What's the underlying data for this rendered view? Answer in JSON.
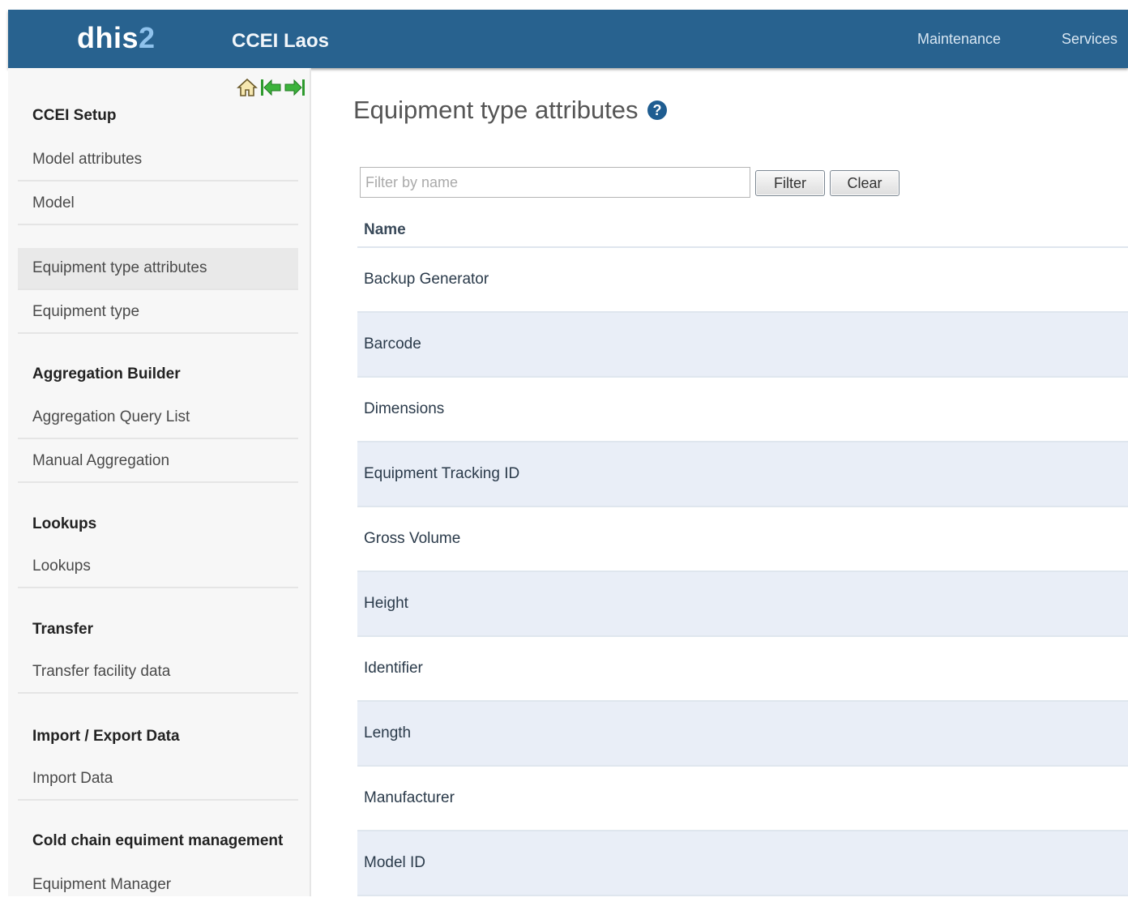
{
  "header": {
    "logo_main": "dhis",
    "logo_num": "2",
    "instance": "CCEI Laos",
    "nav": [
      "Maintenance",
      "Services"
    ]
  },
  "sidebar": {
    "icons": [
      "home-icon",
      "arrow-left-icon",
      "arrow-right-icon"
    ],
    "sections": [
      {
        "title": "CCEI Setup",
        "items": [
          "Model attributes",
          "Model",
          "Equipment type attributes",
          "Equipment type"
        ]
      },
      {
        "title": "Aggregation Builder",
        "items": [
          "Aggregation Query List",
          "Manual Aggregation"
        ]
      },
      {
        "title": "Lookups",
        "items": [
          "Lookups"
        ]
      },
      {
        "title": "Transfer",
        "items": [
          "Transfer facility data"
        ]
      },
      {
        "title": "Import / Export Data",
        "items": [
          "Import Data"
        ]
      },
      {
        "title": "Cold chain equiment management",
        "items": [
          "Equipment Manager"
        ]
      }
    ],
    "active_item": "Equipment type attributes"
  },
  "main": {
    "title": "Equipment type attributes",
    "filter_placeholder": "Filter by name",
    "filter_value": "",
    "filter_button": "Filter",
    "clear_button": "Clear",
    "column_header": "Name",
    "rows": [
      "Backup Generator",
      "Barcode",
      "Dimensions",
      "Equipment Tracking ID",
      "Gross Volume",
      "Height",
      "Identifier",
      "Length",
      "Manufacturer",
      "Model ID"
    ]
  },
  "colors": {
    "header_bg": "#28628f",
    "logo_accent": "#8fc2ec",
    "row_alt": "#e9eef7",
    "sidebar_bg": "#f7f7f7"
  }
}
